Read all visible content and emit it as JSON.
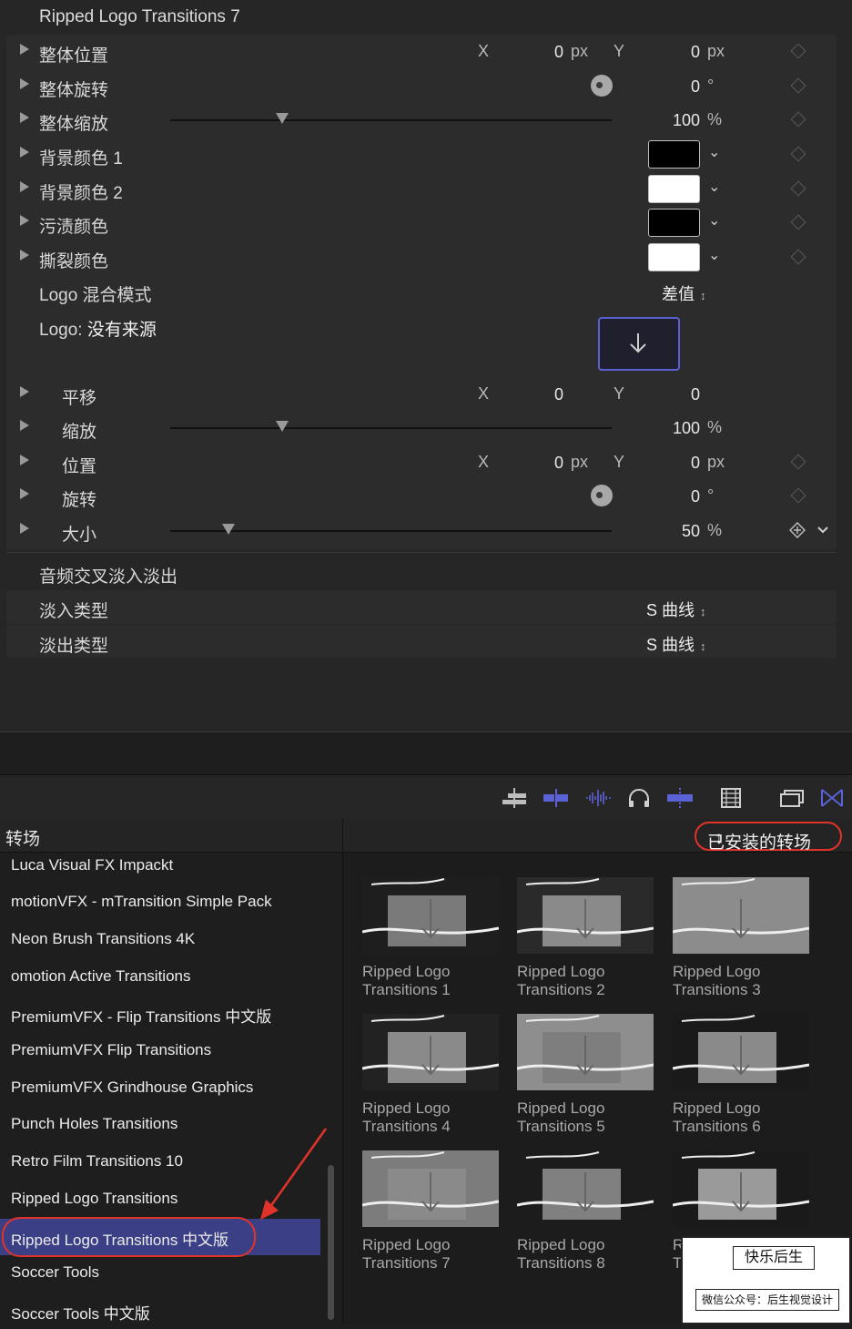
{
  "inspector": {
    "title": "Ripped Logo Transitions 7",
    "rows": [
      {
        "label": "整体位置",
        "x_label": "X",
        "x_value": "0",
        "x_unit": "px",
        "y_label": "Y",
        "y_value": "0",
        "y_unit": "px"
      },
      {
        "label": "整体旋转",
        "value": "0",
        "unit": "°"
      },
      {
        "label": "整体缩放",
        "value": "100",
        "unit": "%",
        "slider_level": 0.26
      },
      {
        "label": "背景颜色 1",
        "color": "#000000"
      },
      {
        "label": "背景颜色 2",
        "color": "#ffffff"
      },
      {
        "label": "污渍颜色",
        "color": "#000000"
      },
      {
        "label": "撕裂颜色",
        "color": "#ffffff"
      },
      {
        "label": "Logo 混合模式",
        "popup": "差值"
      },
      {
        "label_prefix": "Logo:",
        "label_value": "没有来源"
      },
      {
        "label": "平移",
        "x_label": "X",
        "x_value": "0",
        "y_label": "Y",
        "y_value": "0"
      },
      {
        "label": "缩放",
        "value": "100",
        "unit": "%",
        "slider_level": 0.26
      },
      {
        "label": "位置",
        "x_label": "X",
        "x_value": "0",
        "x_unit": "px",
        "y_label": "Y",
        "y_value": "0",
        "y_unit": "px"
      },
      {
        "label": "旋转",
        "value": "0",
        "unit": "°"
      },
      {
        "label": "大小",
        "value": "50",
        "unit": "%",
        "slider_level": 0.13
      }
    ],
    "audio_section_title": "音频交叉淡入淡出",
    "fade_in_label": "淡入类型",
    "fade_in_value": "S 曲线",
    "fade_out_label": "淡出类型",
    "fade_out_value": "S 曲线"
  },
  "toolbar": {
    "icons": [
      "clip-connect-icon",
      "clip-edit-icon",
      "audio-waveform-icon",
      "headphones-icon",
      "skimming-icon",
      "filmstrip-icon",
      "browser-stack-icon",
      "transitions-browser-icon"
    ]
  },
  "sidebar": {
    "title": "转场",
    "items": [
      "Luca Visual FX Impackt",
      "motionVFX - mTransition Simple Pack",
      "Neon Brush Transitions 4K",
      "omotion Active Transitions",
      "PremiumVFX - Flip Transitions 中文版",
      "PremiumVFX Flip Transitions",
      "PremiumVFX Grindhouse Graphics",
      "Punch Holes Transitions",
      "Retro Film Transitions 10",
      "Ripped Logo Transitions",
      "Ripped Logo Transitions 中文版",
      "Soccer Tools",
      "Soccer Tools 中文版"
    ],
    "selected_index": 10
  },
  "grid": {
    "filter_label": "已安装的转场",
    "items": [
      {
        "line1": "Ripped Logo",
        "line2": "Transitions 1"
      },
      {
        "line1": "Ripped Logo",
        "line2": "Transitions 2"
      },
      {
        "line1": "Ripped Logo",
        "line2": "Transitions 3"
      },
      {
        "line1": "Ripped Logo",
        "line2": "Transitions 4"
      },
      {
        "line1": "Ripped Logo",
        "line2": "Transitions 5"
      },
      {
        "line1": "Ripped Logo",
        "line2": "Transitions 6"
      },
      {
        "line1": "Ripped Logo",
        "line2": "Transitions 7"
      },
      {
        "line1": "Ripped Logo",
        "line2": "Transitions 8"
      },
      {
        "line1": "Ripped Logo",
        "line2": "Transit"
      }
    ]
  },
  "watermark": {
    "top_text": "快乐后生",
    "bottom_text": "微信公众号：后生视觉设计"
  }
}
